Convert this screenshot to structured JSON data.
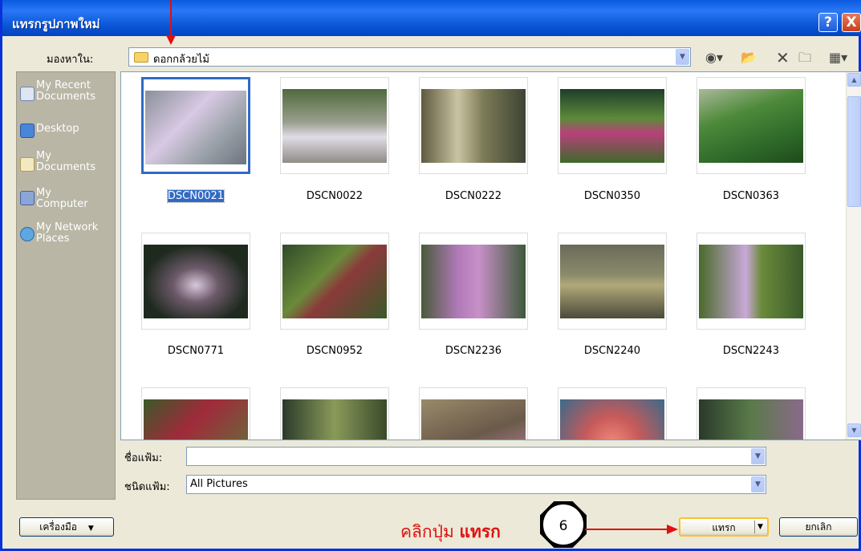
{
  "window": {
    "title": "แทรกรูปภาพใหม่",
    "help": "?",
    "close": "X"
  },
  "lookin": {
    "label": "มองหาใน:",
    "value": "ดอกกล้วยไม้"
  },
  "places": [
    {
      "label": "My Recent\nDocuments",
      "icon": "recent-documents-icon"
    },
    {
      "label": "Desktop",
      "icon": "desktop-icon"
    },
    {
      "label": "My\nDocuments",
      "icon": "my-documents-icon"
    },
    {
      "label": "My\nComputer",
      "icon": "my-computer-icon"
    },
    {
      "label": "My Network\nPlaces",
      "icon": "network-places-icon"
    }
  ],
  "files": [
    {
      "name": "DSCN0021",
      "selected": true
    },
    {
      "name": "DSCN0022"
    },
    {
      "name": "DSCN0222"
    },
    {
      "name": "DSCN0350"
    },
    {
      "name": "DSCN0363"
    },
    {
      "name": "DSCN0771"
    },
    {
      "name": "DSCN0952"
    },
    {
      "name": "DSCN2236"
    },
    {
      "name": "DSCN2240"
    },
    {
      "name": "DSCN2243"
    }
  ],
  "filename": {
    "label": "ชื่อแฟ้ม:",
    "value": ""
  },
  "filetype": {
    "label": "ชนิดแฟ้ม:",
    "value": "All Pictures"
  },
  "buttons": {
    "tools": "เครื่องมือ",
    "insert": "แทรก",
    "cancel": "ยกเลิก"
  },
  "annotation": {
    "text_prefix": "คลิกปุ่ม ",
    "text_bold": "แทรก",
    "step": "6",
    "color": "#e01010"
  }
}
